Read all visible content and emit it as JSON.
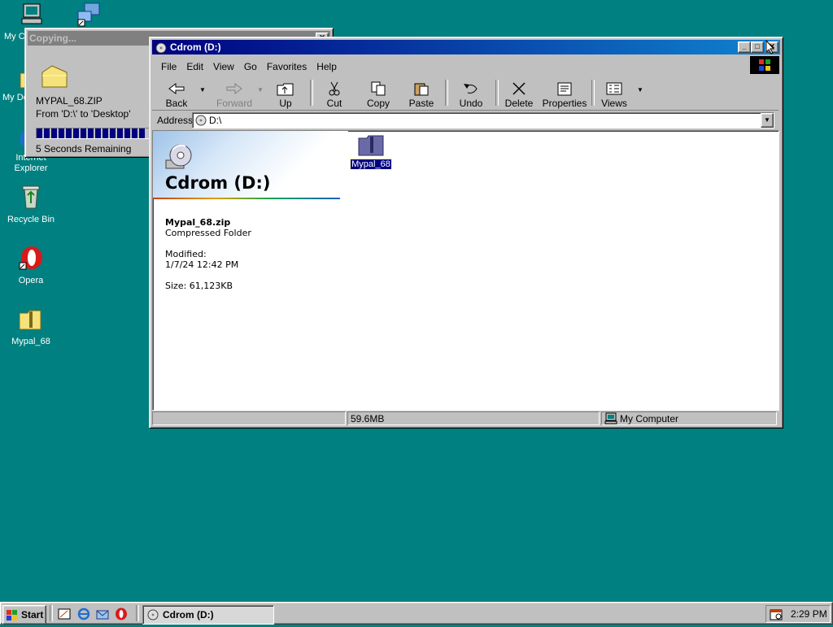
{
  "desktop": {
    "icons": [
      {
        "label": "My Computer",
        "shown": "My C"
      },
      {
        "label": "Network",
        "shown": ""
      },
      {
        "label": "My Documents",
        "shown": "My Do"
      },
      {
        "label": "Internet Explorer",
        "shown": "Internet\nExplorer"
      },
      {
        "label": "Recycle Bin",
        "shown": "Recycle Bin"
      },
      {
        "label": "Opera",
        "shown": "Opera"
      },
      {
        "label": "Mypal_68",
        "shown": "Mypal_68"
      }
    ]
  },
  "copy_dialog": {
    "title": "Copying...",
    "file": "MYPAL_68.ZIP",
    "from_to": "From 'D:\\' to 'Desktop'",
    "remaining": "5 Seconds Remaining",
    "progress": 0.95
  },
  "explorer": {
    "title": "Cdrom (D:)",
    "menu": [
      "File",
      "Edit",
      "View",
      "Go",
      "Favorites",
      "Help"
    ],
    "toolbar": {
      "back": "Back",
      "forward": "Forward",
      "up": "Up",
      "cut": "Cut",
      "copy": "Copy",
      "paste": "Paste",
      "undo": "Undo",
      "delete": "Delete",
      "properties": "Properties",
      "views": "Views"
    },
    "address_label": "Address",
    "address_value": "D:\\",
    "left_panel": {
      "heading": "Cdrom (D:)",
      "file_name": "Mypal_68.zip",
      "file_type": "Compressed Folder",
      "modified_label": "Modified:",
      "modified_value": "1/7/24 12:42 PM",
      "size": "Size: 61,123KB"
    },
    "items": [
      {
        "label": "Mypal_68",
        "selected": true
      }
    ],
    "status": {
      "size": "59.6MB",
      "zone": "My Computer"
    }
  },
  "taskbar": {
    "start": "Start",
    "task": "Cdrom (D:)",
    "clock": "2:29 PM"
  },
  "colors": {
    "desktop": "#008080",
    "title_active_start": "#000080",
    "title_active_end": "#1084d0",
    "selection": "#000080"
  }
}
